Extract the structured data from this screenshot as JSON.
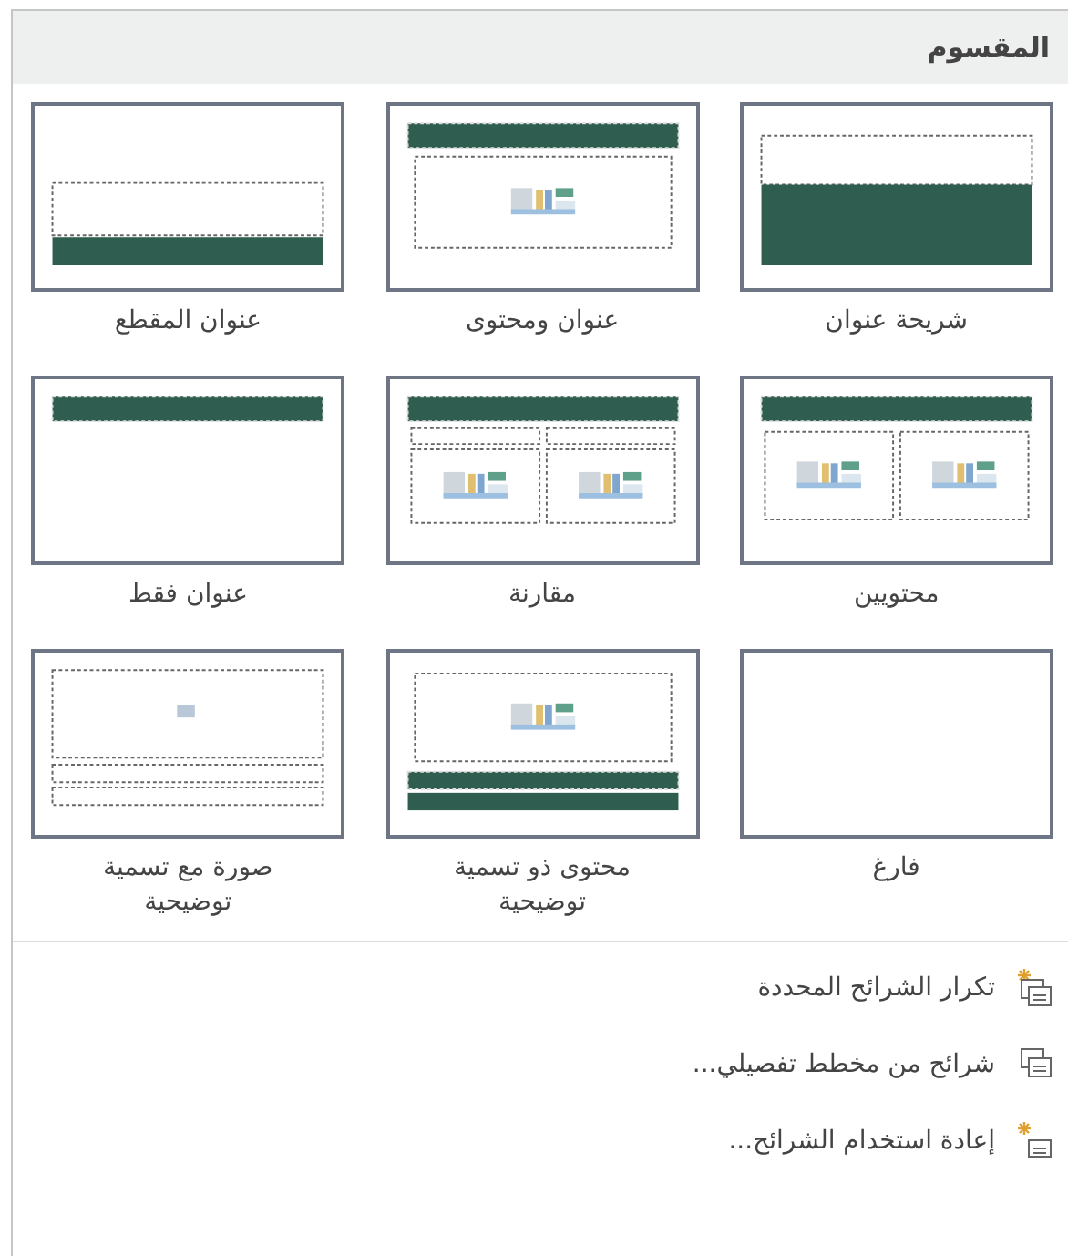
{
  "section": {
    "title": "المقسوم"
  },
  "layouts": [
    {
      "kind": "title",
      "label": "شريحة عنوان"
    },
    {
      "kind": "title_content",
      "label": "عنوان ومحتوى"
    },
    {
      "kind": "section",
      "label": "عنوان المقطع"
    },
    {
      "kind": "two_content",
      "label": "محتويين"
    },
    {
      "kind": "comparison",
      "label": "مقارنة"
    },
    {
      "kind": "title_only",
      "label": "عنوان فقط"
    },
    {
      "kind": "blank",
      "label": "فارغ"
    },
    {
      "kind": "content_caption",
      "label": "محتوى ذو تسمية توضيحية"
    },
    {
      "kind": "picture_caption",
      "label": "صورة مع تسمية توضيحية"
    }
  ],
  "menu": [
    {
      "kind": "duplicate",
      "label": "تكرار الشرائح المحددة"
    },
    {
      "kind": "outline",
      "label": "شرائح من مخطط تفصيلي..."
    },
    {
      "kind": "reuse",
      "label": "إعادة استخدام الشرائح..."
    }
  ]
}
